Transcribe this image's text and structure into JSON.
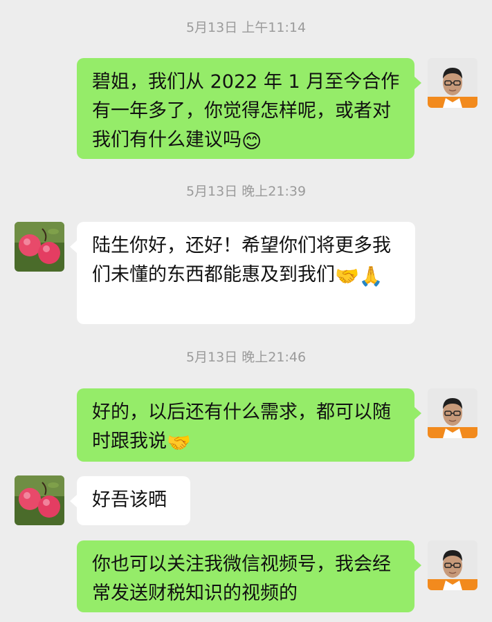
{
  "messages": [
    {
      "type": "timestamp",
      "text": "5月13日 上午11:14"
    },
    {
      "type": "msg",
      "from": "me",
      "text": "碧姐，我们从 2022 年 1 月至今合作有一年多了，你觉得怎样呢，或者对我们有什么建议吗",
      "emoji": "😊"
    },
    {
      "type": "timestamp",
      "text": "5月13日 晚上21:39"
    },
    {
      "type": "msg",
      "from": "other",
      "text": "陆生你好，还好！希望你们将更多我们未懂的东西都能惠及到我们",
      "emoji": "🤝🙏"
    },
    {
      "type": "timestamp",
      "text": "5月13日 晚上21:46"
    },
    {
      "type": "msg",
      "from": "me",
      "text": "好的，以后还有什么需求，都可以随时跟我说",
      "emoji": "🤝"
    },
    {
      "type": "msg",
      "from": "other",
      "text": "好吾该晒"
    },
    {
      "type": "msg",
      "from": "me",
      "text": "你也可以关注我微信视频号，我会经常发送财税知识的视频的"
    }
  ],
  "avatars": {
    "me": "man-with-glasses-avatar",
    "other": "pink-apples-avatar"
  },
  "colors": {
    "background": "#ededed",
    "my_bubble": "#95ec69",
    "other_bubble": "#ffffff",
    "timestamp": "#9a9a9a"
  }
}
